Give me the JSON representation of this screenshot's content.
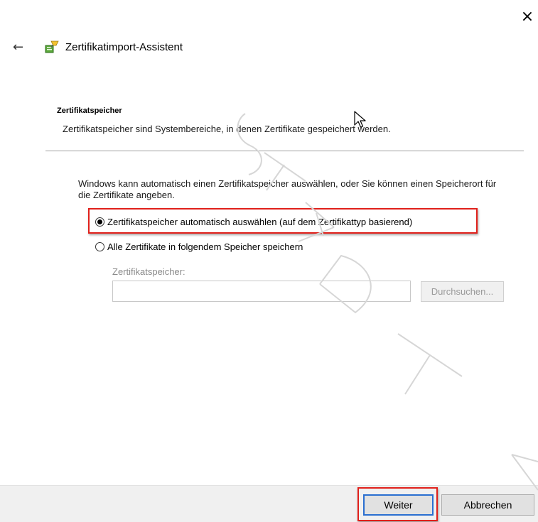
{
  "window": {
    "title": "Zertifikatimport-Assistent",
    "close_glyph": "×",
    "back_glyph": "←"
  },
  "section": {
    "heading": "Zertifikatspeicher",
    "description": "Zertifikatspeicher sind Systembereiche, in denen Zertifikate gespeichert werden."
  },
  "intro": "Windows kann automatisch einen Zertifikatspeicher auswählen, oder Sie können einen Speicherort für die Zertifikate angeben.",
  "options": {
    "auto": {
      "label": "Zertifikatspeicher automatisch auswählen (auf dem Zertifikattyp basierend)",
      "selected": true
    },
    "manual": {
      "label": "Alle Zertifikate in folgendem Speicher speichern",
      "selected": false
    }
  },
  "store": {
    "label": "Zertifikatspeicher:",
    "value": "",
    "browse_label": "Durchsuchen..."
  },
  "footer": {
    "next_label": "Weiter",
    "cancel_label": "Abbrechen"
  },
  "colors": {
    "highlight": "#e0201b",
    "focus_border": "#2a6fd0",
    "footer_bg": "#f0f0f0"
  },
  "icons": [
    "close-icon",
    "back-arrow-icon",
    "certificate-wizard-icon",
    "mouse-cursor-icon"
  ]
}
